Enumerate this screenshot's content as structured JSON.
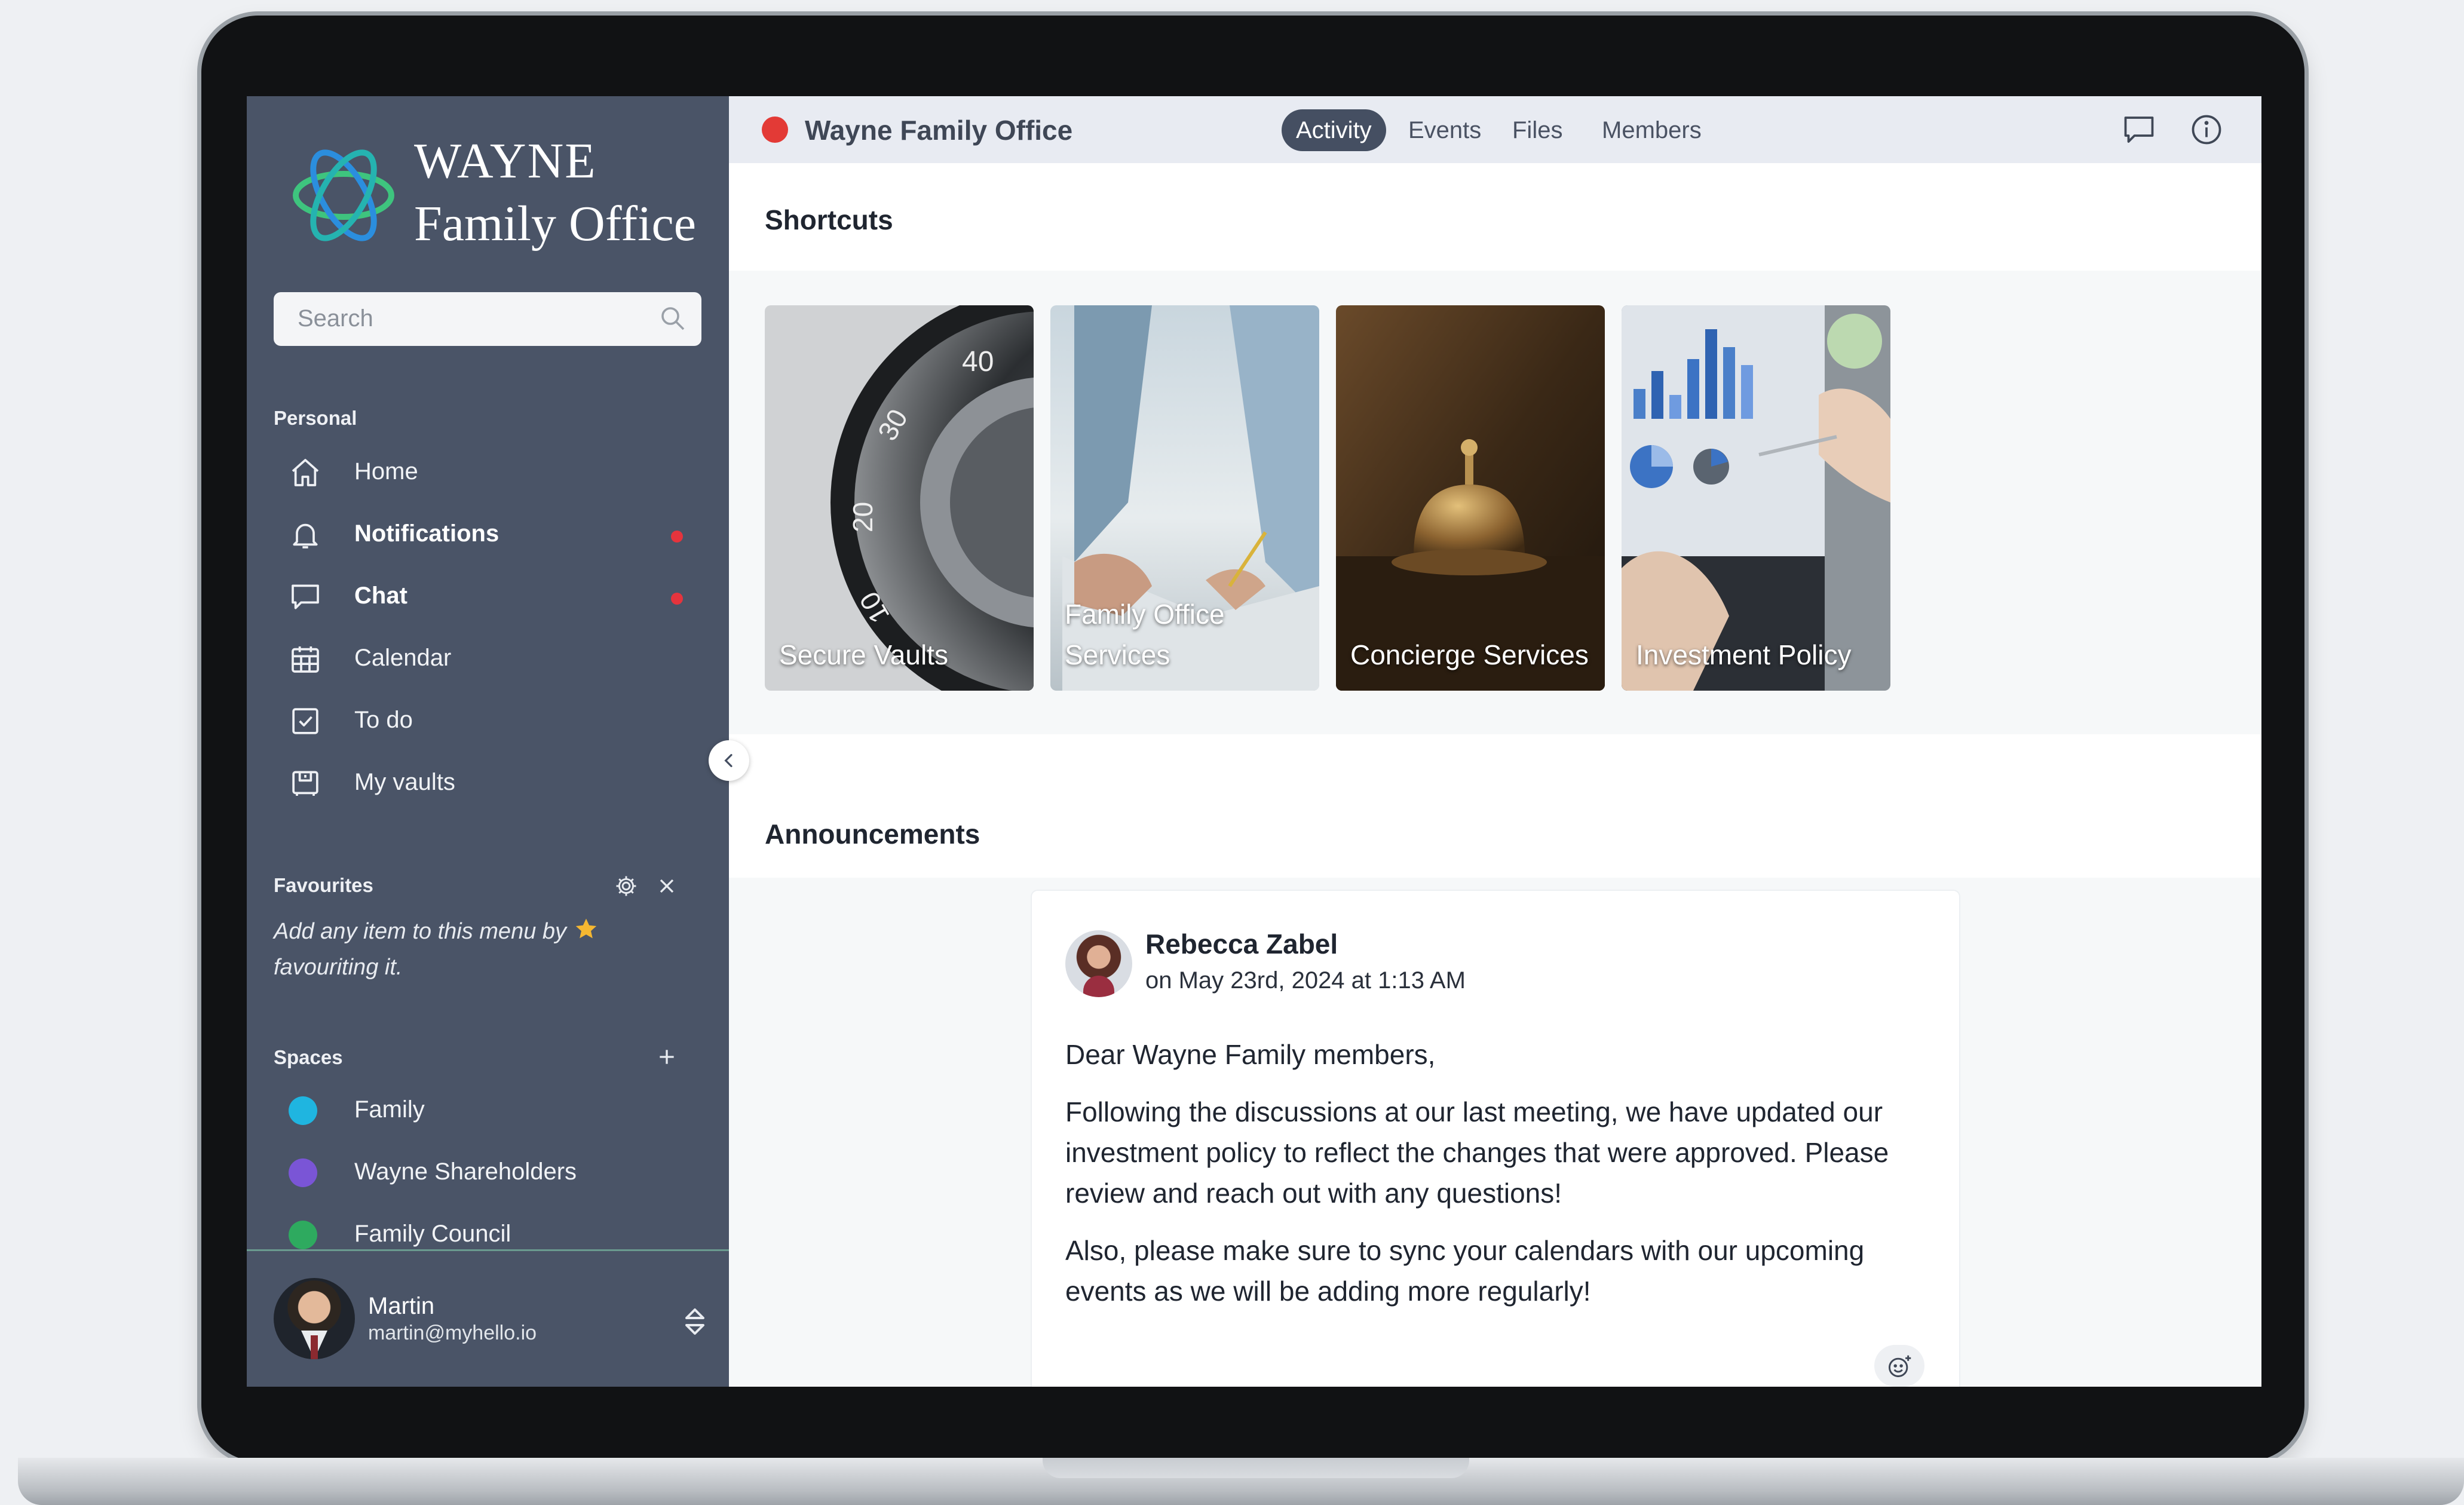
{
  "brand": {
    "line1": "WAYNE",
    "line2": "Family Office",
    "logo_icon": "interlocking-rings-logo",
    "colors": {
      "green": "#3ec47e",
      "blue": "#2b8ede",
      "teal": "#25b3b0"
    }
  },
  "sidebar": {
    "search_placeholder": "Search",
    "personal_label": "Personal",
    "personal_items": [
      {
        "label": "Home",
        "icon": "home-icon",
        "bold": false,
        "unread": false
      },
      {
        "label": "Notifications",
        "icon": "bell-icon",
        "bold": true,
        "unread": true
      },
      {
        "label": "Chat",
        "icon": "chat-icon",
        "bold": true,
        "unread": true
      },
      {
        "label": "Calendar",
        "icon": "calendar-icon",
        "bold": false,
        "unread": false
      },
      {
        "label": "To do",
        "icon": "checkbox-icon",
        "bold": false,
        "unread": false
      },
      {
        "label": "My vaults",
        "icon": "vault-icon",
        "bold": false,
        "unread": false
      }
    ],
    "favourites_label": "Favourites",
    "favourites_hint_part1": "Add any item to this menu by",
    "favourites_hint_part2": "favouriting it.",
    "spaces_label": "Spaces",
    "spaces": [
      {
        "label": "Family",
        "color": "#1fb5e0"
      },
      {
        "label": "Wayne Shareholders",
        "color": "#7a55d6"
      },
      {
        "label": "Family Council",
        "color": "#2eaa5f"
      }
    ],
    "user": {
      "name": "Martin",
      "email": "martin@myhello.io"
    },
    "unread_color": "#e5343d"
  },
  "topbar": {
    "title": "Wayne Family Office",
    "status_color": "#e33a36",
    "tabs": [
      {
        "label": "Activity",
        "active": true
      },
      {
        "label": "Events",
        "active": false
      },
      {
        "label": "Files",
        "active": false
      },
      {
        "label": "Members",
        "active": false
      }
    ]
  },
  "shortcuts": {
    "heading": "Shortcuts",
    "items": [
      {
        "label": "Secure Vaults",
        "image": "safe-combination-dial"
      },
      {
        "label": "Family Office Services",
        "image": "hands-signing-document"
      },
      {
        "label": "Concierge Services",
        "image": "reception-bell"
      },
      {
        "label": "Investment Policy",
        "image": "laptop-charts"
      }
    ]
  },
  "announcements": {
    "heading": "Announcements",
    "post": {
      "author": "Rebecca Zabel",
      "date": "on May 23rd, 2024 at 1:13 AM",
      "greeting": "Dear Wayne Family members,",
      "paragraph1": "Following the discussions at our last meeting, we have updated our investment policy to reflect the changes that were approved. Please review and reach out with any questions!",
      "paragraph2": "Also, please make sure to sync your calendars with our upcoming events as we will be adding more regularly!"
    }
  }
}
